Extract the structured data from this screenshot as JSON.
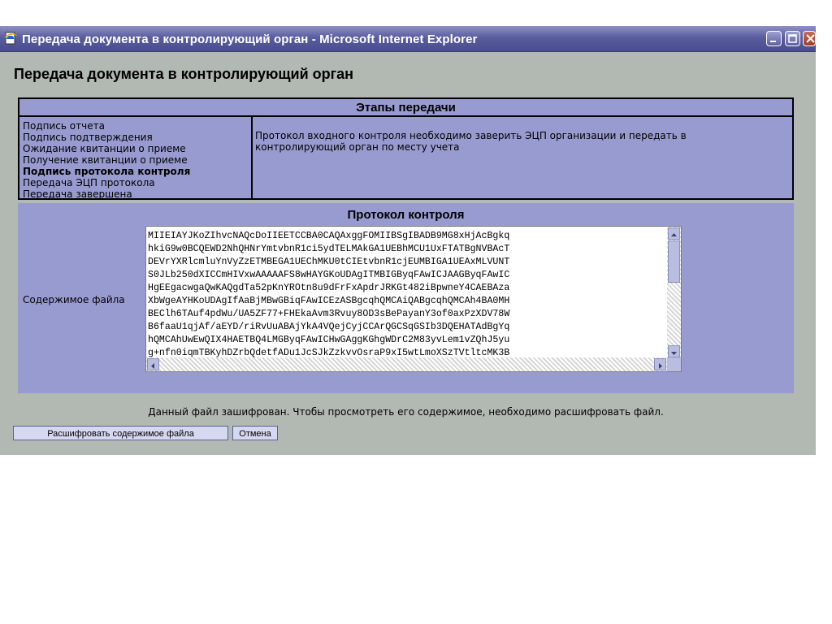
{
  "window": {
    "title": "Передача документа в контролирующий орган - Microsoft Internet Explorer"
  },
  "page": {
    "title": "Передача документа в контролирующий орган"
  },
  "stages": {
    "header": "Этапы передачи",
    "items": [
      "Подпись отчета",
      "Подпись подтверждения",
      "Ожидание квитанции о приеме",
      "Получение квитанции о приеме",
      "Подпись протокола контроля",
      "Передача ЭЦП протокола",
      "Передача завершена"
    ],
    "current_index": 4,
    "description": "Протокол входного контроля необходимо заверить ЭЦП организации и передать в контролирующий орган по месту учета"
  },
  "protocol": {
    "title": "Протокол контроля",
    "file_label": "Содержимое файла",
    "content_lines": [
      "MIIEIAYJKoZIhvcNAQcDoIIEETCCBA0CAQAxggFOMIIBSgIBADB9MG8xHjAcBgkq",
      "hkiG9w0BCQEWD2NhQHNrYmtvbnR1ci5ydTELMAkGA1UEBhMCU1UxFTATBgNVBAcT",
      "DEVrYXRlcmluYnVyZzETMBEGA1UEChMKU0tCIEtvbnR1cjEUMBIGA1UEAxMLVUNT",
      "S0JLb250dXICCmHIVxwAAAAAFS8wHAYGKoUDAgITMBIGByqFAwICJAAGByqFAwIC",
      "HgEEgacwgaQwKAQgdTa52pKnYROtn8u9dFrFxApdrJRKGt482iBpwneY4CAEBAza",
      "XbWgeAYHKoUDAgIfAaBjMBwGBiqFAwICEzASBgcqhQMCAiQABgcqhQMCAh4BA0MH",
      "BEClh6TAuf4pdWu/UA5ZF77+FHEkaAvm3Rvuy8OD3sBePayanY3of0axPzXDV78W",
      "B6faaU1qjAf/aEYD/riRvUuABAjYkA4VQejCyjCCArQGCSqGSIb3DQEHATAdBgYq",
      "hQMCAhUwEwQIX4HAETBQ4LMGByqFAwICHwGAggKGhgWDrC2M83yvLem1vZQhJ5yu",
      "g+nfn0iqmTBKyhDZrbQdetfADu1JcSJkZzkvvOsraP9xI5wtLmoXSzTVtltcMK3B"
    ],
    "note": "Данный файл зашифрован. Чтобы просмотреть его содержимое, необходимо расшифровать файл."
  },
  "buttons": {
    "decrypt": "Расшифровать содержимое файла",
    "cancel": "Отмена"
  },
  "icons": {
    "app": "ie-page-icon",
    "minimize": "minimize-icon",
    "maximize": "maximize-icon",
    "close": "close-icon"
  },
  "colors": {
    "titlebar": "#5b5e9e",
    "panel": "#989bd0",
    "window_bg": "#b2b8b2",
    "button_bg": "#d6d8f0"
  }
}
